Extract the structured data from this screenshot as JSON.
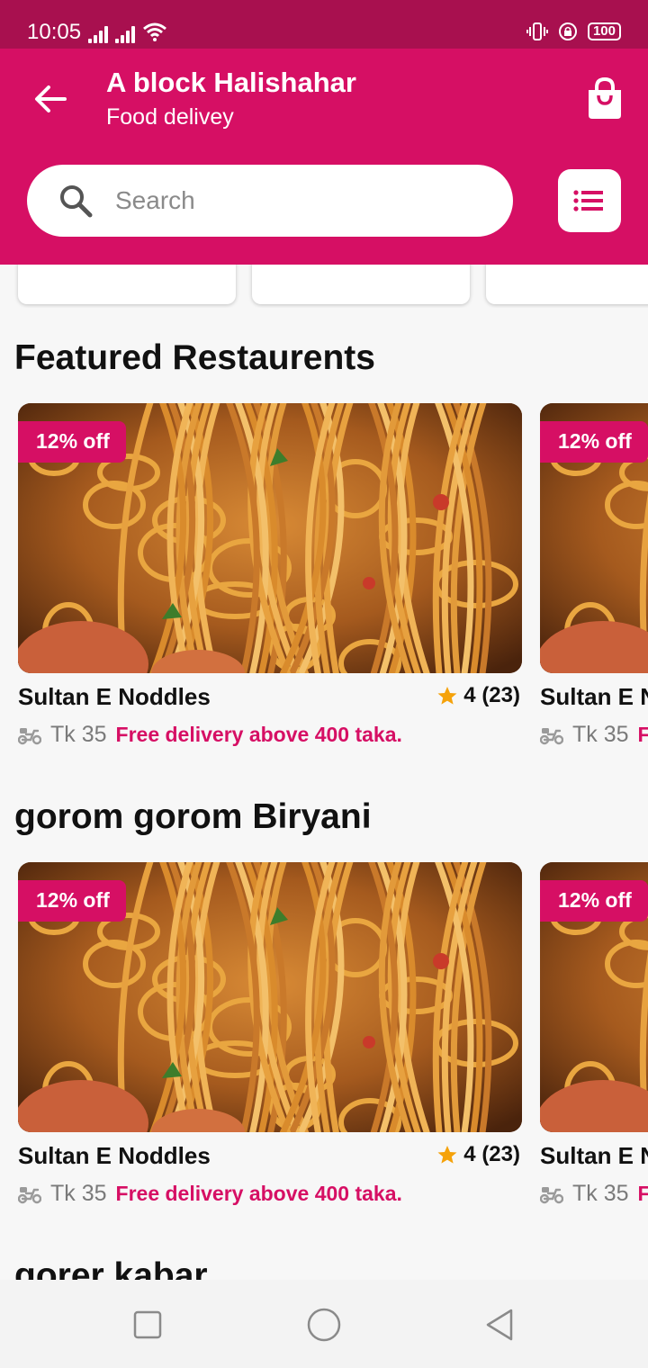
{
  "status_bar": {
    "time": "10:05",
    "battery": "100"
  },
  "header": {
    "title": "A block Halishahar",
    "subtitle": "Food delivey"
  },
  "search": {
    "placeholder": "Search"
  },
  "sections": [
    {
      "title": "Featured Restaurents"
    },
    {
      "title": "gorom gorom Biryani"
    },
    {
      "title": "gorer kabar"
    }
  ],
  "restaurant_card": {
    "discount": "12% off",
    "name": "Sultan E Noddles",
    "rating": "4 (23)",
    "delivery_fee": "Tk 35",
    "promo": "Free delivery above 400 taka."
  },
  "icons": {
    "back": "arrow-left-icon",
    "bag": "shopping-bag-icon",
    "search": "search-icon",
    "filter": "list-icon",
    "star": "star-icon",
    "delivery": "scooter-icon"
  },
  "colors": {
    "brand": "#d60f64",
    "status_bar": "#a8104f",
    "star": "#f5a20a"
  }
}
